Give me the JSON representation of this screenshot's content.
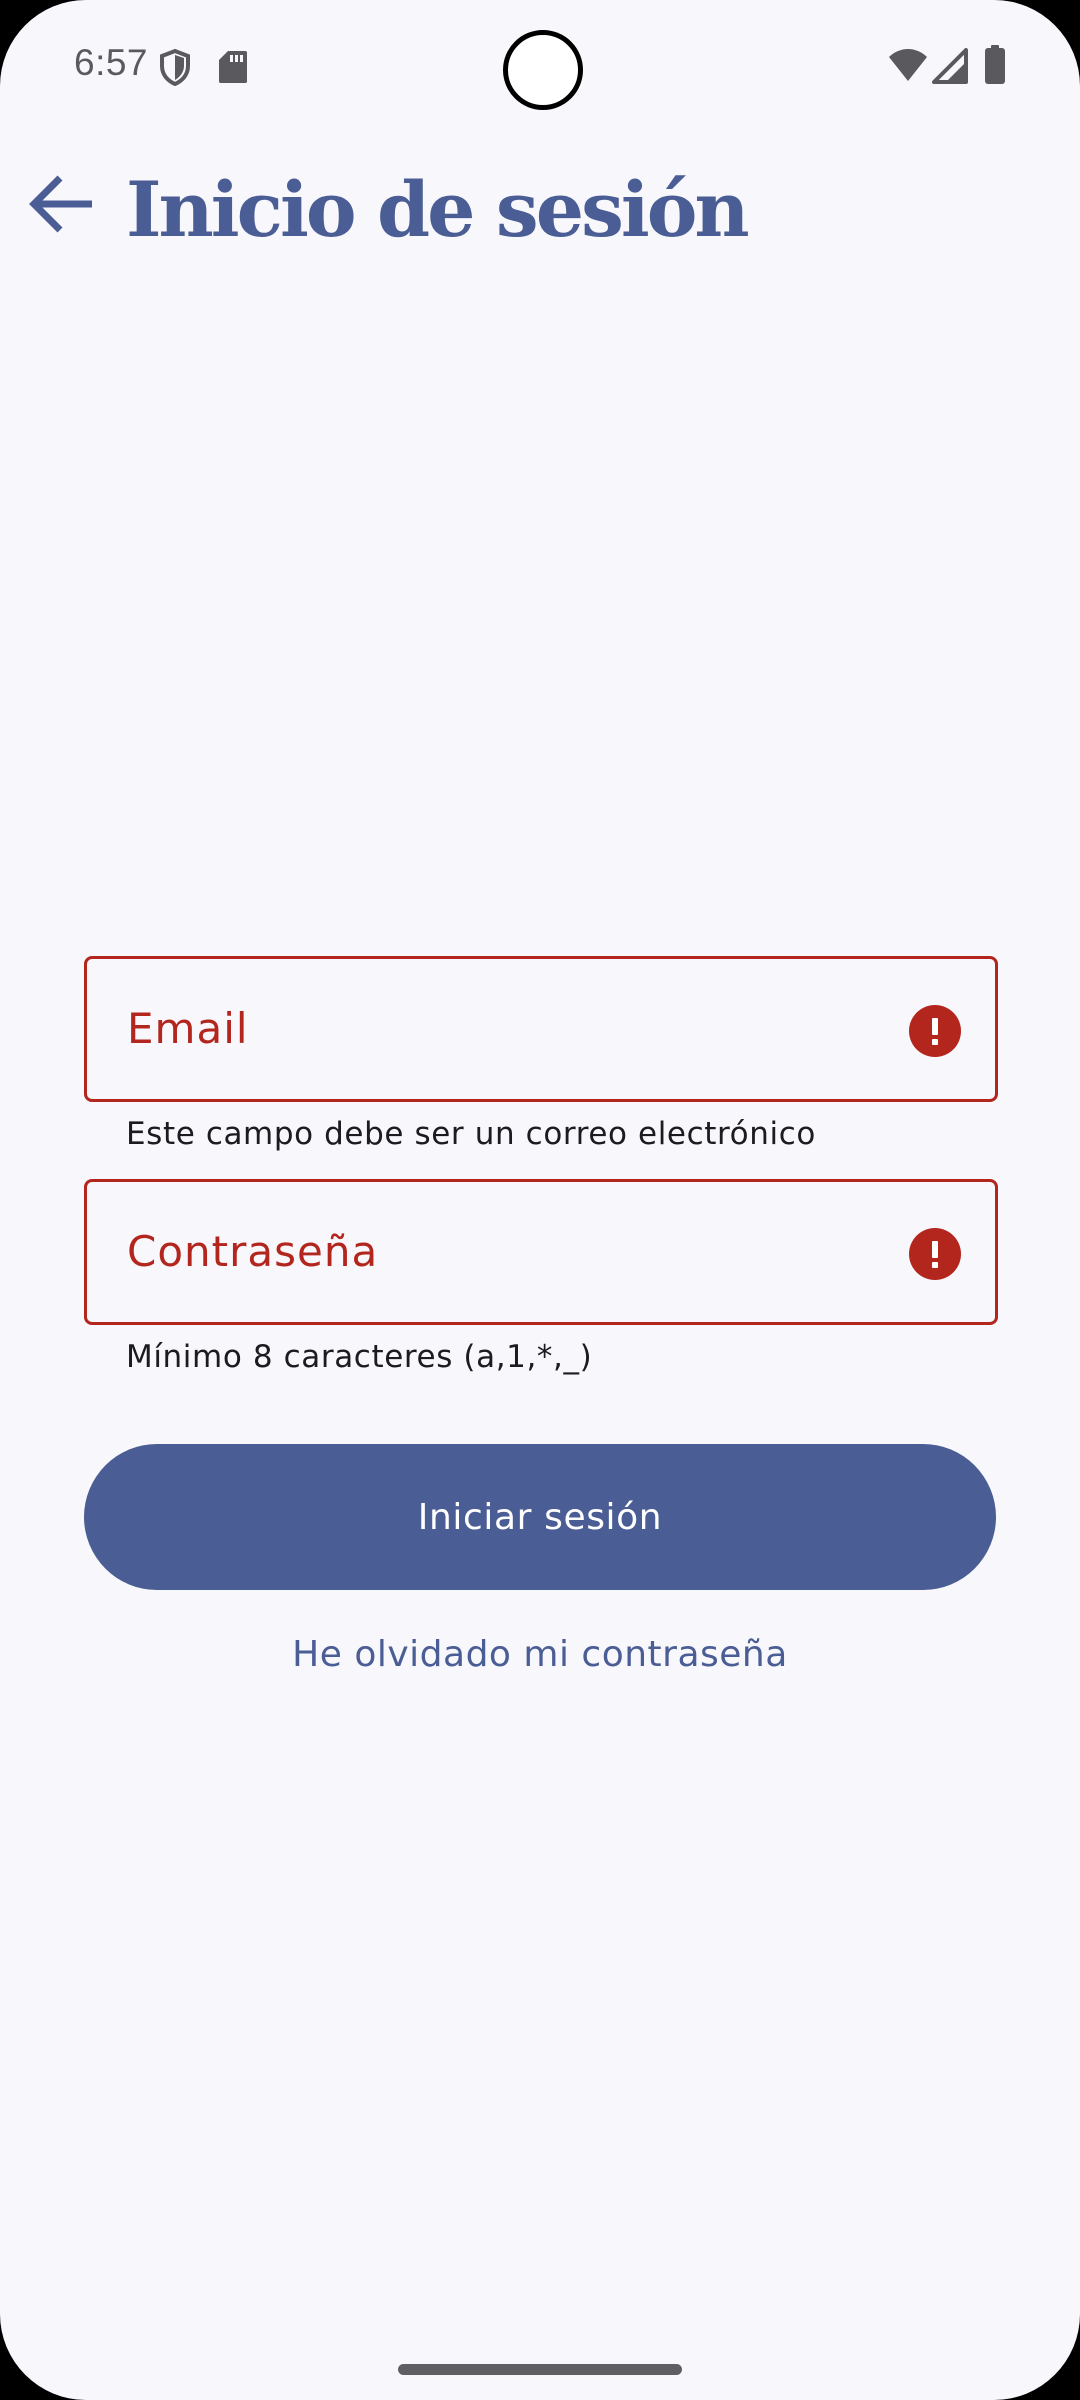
{
  "status_bar": {
    "time": "6:57",
    "icons": [
      "shield-icon",
      "sd-card-icon",
      "wifi-icon",
      "cell-signal-icon",
      "battery-icon"
    ]
  },
  "app_bar": {
    "back_icon": "arrow-back-icon",
    "title": "Inicio de sesión"
  },
  "form": {
    "email": {
      "label": "Email",
      "value": "",
      "helper": "Este campo debe ser un correo electrónico",
      "error_icon": "error-icon"
    },
    "password": {
      "label": "Contraseña",
      "value": "",
      "helper": "Mínimo 8 caracteres (a,1,*,_)",
      "error_icon": "error-icon"
    },
    "submit_label": "Iniciar sesión",
    "forgot_label": "He olvidado mi contraseña"
  },
  "colors": {
    "primary": "#4a5d94",
    "error": "#b3261e",
    "background": "#f8f7fc"
  }
}
